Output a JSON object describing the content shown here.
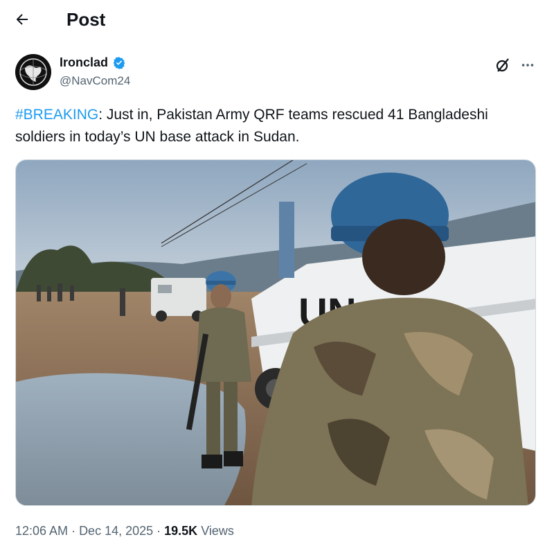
{
  "header": {
    "title": "Post"
  },
  "author": {
    "name": "Ironclad",
    "handle": "@NavCom24"
  },
  "post": {
    "hashtag": "#BREAKING",
    "text": ": Just in, Pakistan Army QRF teams rescued 41 Bangladeshi soldiers in today’s UN base attack in Sudan."
  },
  "media": {
    "vehicle_text": "UN"
  },
  "meta": {
    "time": "12:06 AM",
    "sep1": " · ",
    "date": "Dec 14, 2025",
    "sep2": " · ",
    "views_count": "19.5K",
    "views_label": " Views"
  },
  "colors": {
    "accent": "#1d9bf0",
    "secondary": "#536471",
    "verified": "#1d9bf0"
  },
  "icons": {
    "back": "arrow-left-icon",
    "verified": "verified-badge-icon",
    "grok": "grok-icon",
    "more": "more-icon"
  }
}
